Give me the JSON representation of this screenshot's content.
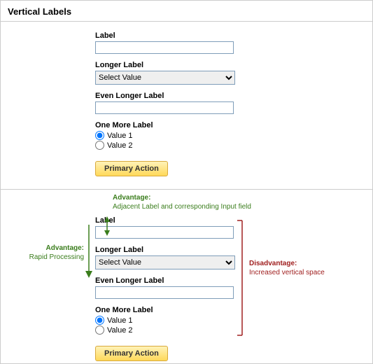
{
  "heading": "Vertical Labels",
  "form": {
    "label1": "Label",
    "label2": "Longer Label",
    "select_value": "Select Value",
    "label3": "Even Longer Label",
    "label4": "One More Label",
    "radio1": "Value 1",
    "radio2": "Value 2",
    "primary_action": "Primary Action"
  },
  "annotations": {
    "adv_top_title": "Advantage:",
    "adv_top_body": "Adjacent Label and corresponding Input field",
    "adv_left_title": "Advantage:",
    "adv_left_body": "Rapid Processing",
    "dis_right_title": "Disadvantage:",
    "dis_right_body": "Increased vertical space"
  }
}
